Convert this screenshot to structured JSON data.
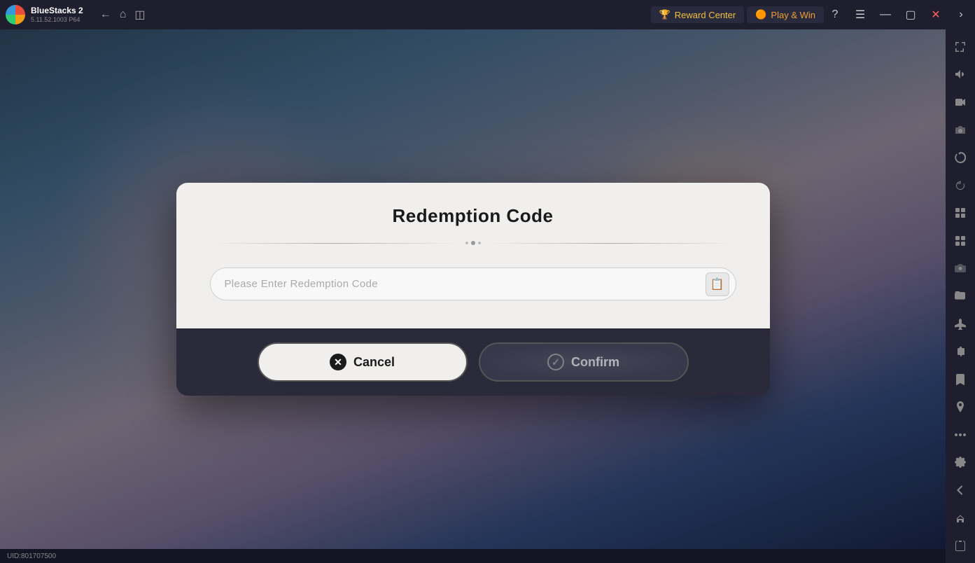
{
  "app": {
    "name": "BlueStacks 2",
    "version": "5.11.52.1003",
    "build": "P64",
    "uid_label": "UID:801707500"
  },
  "topbar": {
    "reward_center_label": "Reward Center",
    "play_win_label": "Play & Win",
    "back_tooltip": "Back",
    "home_tooltip": "Home",
    "tabs_tooltip": "Tabs",
    "help_tooltip": "Help",
    "menu_tooltip": "Menu",
    "minimize_tooltip": "Minimize",
    "maximize_tooltip": "Maximize",
    "close_tooltip": "Close",
    "expand_tooltip": "Expand"
  },
  "sidebar": {
    "icons": [
      "fullscreen-icon",
      "volume-icon",
      "video-icon",
      "screenshot-icon",
      "replay-icon",
      "refresh-icon",
      "build-icon",
      "library-icon",
      "camera-icon",
      "folder-icon",
      "airplane-icon",
      "scale-icon",
      "bookmark-icon",
      "location-icon",
      "more-icon",
      "settings-icon",
      "back-nav-icon",
      "home-nav-icon",
      "copy-nav-icon"
    ]
  },
  "dialog": {
    "title": "Redemption Code",
    "input_placeholder": "Please Enter Redemption Code",
    "cancel_label": "Cancel",
    "confirm_label": "Confirm"
  }
}
